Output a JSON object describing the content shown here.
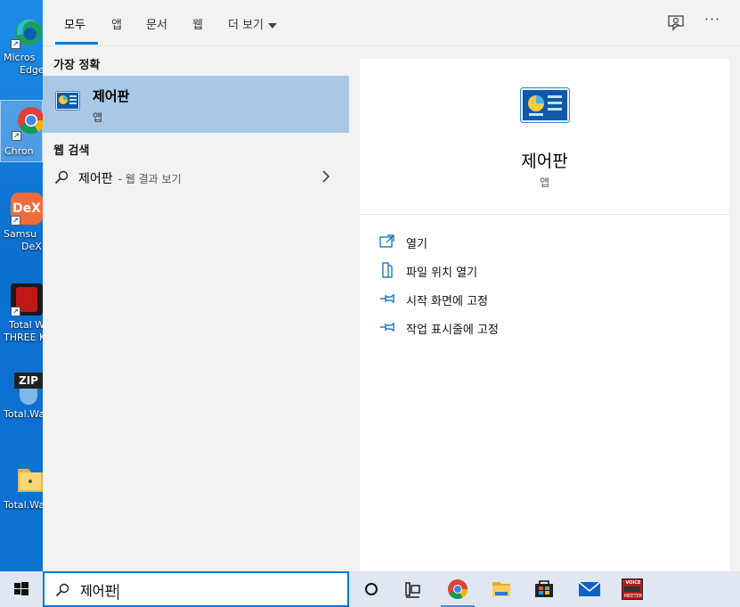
{
  "desktop": {
    "icons": [
      {
        "label_1": "Micros",
        "label_2": "Edge"
      },
      {
        "label_1": "Chron",
        "label_2": ""
      },
      {
        "label_1": "Samsu",
        "label_2": "DeX"
      },
      {
        "label_1": "Total W",
        "label_2": "THREE K"
      },
      {
        "label_1": "Total.Wa",
        "label_2": ""
      },
      {
        "label_1": "Total.Wa",
        "label_2": ""
      }
    ],
    "zip_badge": "ZIP",
    "dex_badge": "DeX"
  },
  "tabs": [
    {
      "label": "모두"
    },
    {
      "label": "앱"
    },
    {
      "label": "문서"
    },
    {
      "label": "웹"
    },
    {
      "label": "더 보기"
    }
  ],
  "toolbar": {
    "more_label": "···"
  },
  "left": {
    "best_match_header": "가장 정확",
    "best_match": {
      "title": "제어판",
      "subtitle": "앱"
    },
    "web_header": "웹 검색",
    "web_result": {
      "query": "제어판",
      "suffix": "- 웹 결과 보기"
    }
  },
  "detail": {
    "title": "제어판",
    "subtitle": "앱",
    "actions": [
      {
        "label": "열기",
        "icon": "open-icon"
      },
      {
        "label": "파일 위치 열기",
        "icon": "file-location-icon"
      },
      {
        "label": "시작 화면에 고정",
        "icon": "pin-icon"
      },
      {
        "label": "작업 표시줄에 고정",
        "icon": "pin-icon"
      }
    ]
  },
  "taskbar": {
    "search_value": "제어판",
    "voicemeeter_top": "VOICE",
    "voicemeeter_bottom": "MEETER"
  },
  "colors": {
    "accent": "#0078d7",
    "selected_row": "#a8c8e6",
    "menu_bg": "#f2f2f2",
    "desktop": "#0b6fd0"
  }
}
